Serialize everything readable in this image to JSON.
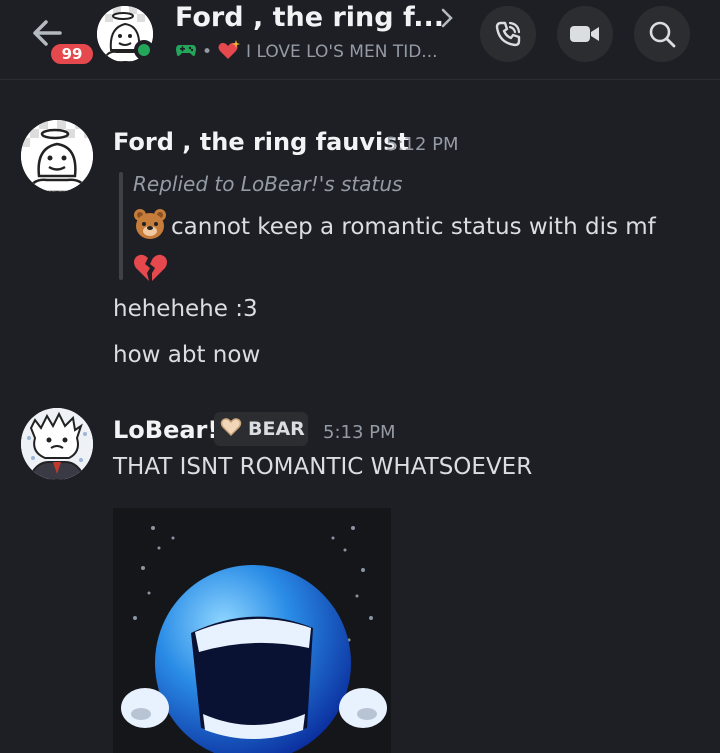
{
  "header": {
    "unread_count": "99",
    "title": "Ford , the ring f...",
    "status_text": "I LOVE LO'S MEN TID..."
  },
  "messages": [
    {
      "author": "Ford , the ring fauvist",
      "time": "5:12 PM",
      "reply_label": "Replied to LoBear!'s status",
      "reply_text": "cannot keep a romantic status with dis mf",
      "lines": [
        "hehehehe :3",
        "how abt now"
      ]
    },
    {
      "author": "LoBear!",
      "tag": "BEAR",
      "time": "5:13 PM",
      "lines": [
        "THAT ISNT ROMANTIC WHATSOEVER"
      ]
    }
  ],
  "colors": {
    "background": "#1e1f25",
    "badge": "#e5484d",
    "online": "#23a55a",
    "muted_text": "#949ba4"
  },
  "icons": {
    "back": "arrow-left-icon",
    "call": "phone-call-icon",
    "video": "video-camera-icon",
    "search": "search-icon",
    "game": "gamepad-icon",
    "heart": "sparkle-heart-icon",
    "bear": "bear-face-icon",
    "broken_heart": "broken-heart-icon"
  }
}
